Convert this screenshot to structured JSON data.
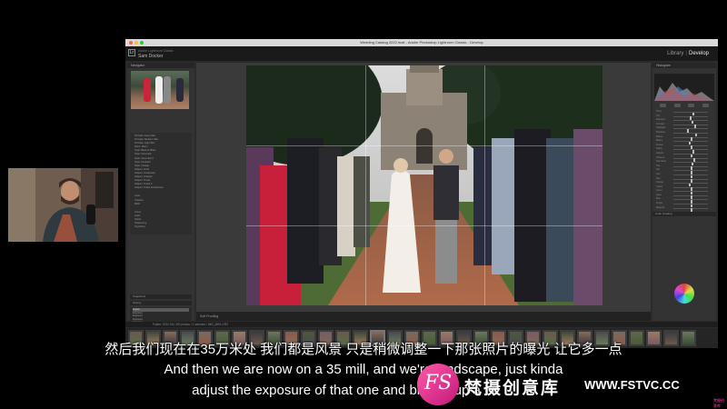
{
  "window": {
    "title": "Wedding Catalog 2022.lrcat - Adobe Photoshop Lightroom Classic - Develop",
    "identity_small": "Adobe Lightroom Classic",
    "identity_name": "Sam Docker",
    "modules": [
      "Library",
      "Develop"
    ],
    "active_module": "Develop"
  },
  "left_panel": {
    "navigator_label": "Navigator",
    "presets": [
      "Portraits: Deep Skin",
      "Portraits: Medium Skin",
      "Portraits: Light Skin",
      "Retro: Warm",
      "Style: Black & White",
      "Style: Cinematic",
      "Style: Cinematic II",
      "Style: Futuristic",
      "Style: Vintage",
      "Subject: Food",
      "Subject: Landscape",
      "Subject: Lifestyle",
      "Subject: Travel",
      "Subject: Travel II",
      "Subject: Urban Architecture"
    ],
    "presets_group2": [
      "Color",
      "Creative",
      "B&W"
    ],
    "presets_group3": [
      "Curve",
      "Grain",
      "Optics",
      "Sharpening",
      "Vignetting"
    ],
    "snapshots_label": "Snapshots",
    "history_label": "History",
    "history_items": [
      "Import",
      "Exposure",
      "Exposure",
      "Exposure",
      "Exposure",
      "Exposure"
    ],
    "copy_label": "Copy...",
    "paste_label": "Paste"
  },
  "toolbar": {
    "soft_proofing": "Soft Proofing"
  },
  "right_panel": {
    "histogram_label": "Histogram",
    "sliders": [
      "Temp",
      "Tint",
      "Exposure",
      "Contrast",
      "Highlights",
      "Shadows",
      "Whites",
      "Blacks",
      "Texture",
      "Clarity",
      "Dehaze",
      "Vibrance",
      "Saturation",
      "Hue",
      "Sat",
      "Lum",
      "Red",
      "Orange",
      "Yellow",
      "Green",
      "Aqua",
      "Blue",
      "Purple",
      "Magenta"
    ],
    "color_grading_label": "Color Grading",
    "previous_label": "Previous",
    "reset_label": "Reset"
  },
  "filmstrip": {
    "info": "Folder: 2022-06 | 320 photos / 1 selected / IMG_4891.CR3"
  },
  "subtitles": {
    "cn": "然后我们现在在35万米处 我们都是风景 只是稍微调整一下那张照片的曝光 让它多一点",
    "en1": "And then we are now on a 35 mill, and we're landscape, just kinda",
    "en2": "adjust the exposure of that one and bring it up a bit"
  },
  "watermark": {
    "logo": "FS",
    "cn": "梵摄创意库",
    "url": "WWW.FSTVC.CC",
    "tiny": "梵摄创意库"
  }
}
